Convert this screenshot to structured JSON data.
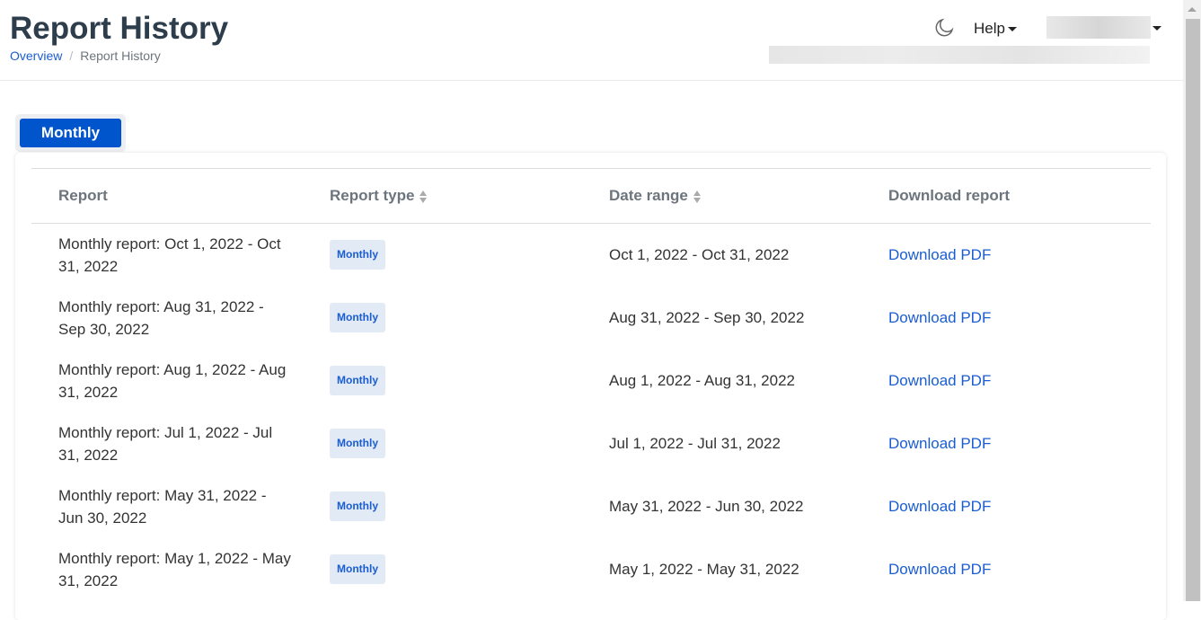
{
  "header": {
    "title": "Report History",
    "breadcrumb": [
      "Overview",
      "Report History"
    ],
    "help": "Help"
  },
  "tabs": [
    "Monthly"
  ],
  "table": {
    "columns": [
      "Report",
      "Report type",
      "Date range",
      "Download report"
    ],
    "rows": [
      {
        "report": "Monthly report: Oct 1, 2022 - Oct 31, 2022",
        "type": "Monthly",
        "range": "Oct 1, 2022 - Oct 31, 2022",
        "download": "Download PDF"
      },
      {
        "report": "Monthly report: Aug 31, 2022 - Sep 30, 2022",
        "type": "Monthly",
        "range": "Aug 31, 2022 - Sep 30, 2022",
        "download": "Download PDF"
      },
      {
        "report": "Monthly report: Aug 1, 2022 - Aug 31, 2022",
        "type": "Monthly",
        "range": "Aug 1, 2022 - Aug 31, 2022",
        "download": "Download PDF"
      },
      {
        "report": "Monthly report: Jul 1, 2022 - Jul 31, 2022",
        "type": "Monthly",
        "range": "Jul 1, 2022 - Jul 31, 2022",
        "download": "Download PDF"
      },
      {
        "report": "Monthly report: May 31, 2022 - Jun 30, 2022",
        "type": "Monthly",
        "range": "May 31, 2022 - Jun 30, 2022",
        "download": "Download PDF"
      },
      {
        "report": "Monthly report: May 1, 2022 - May 31, 2022",
        "type": "Monthly",
        "range": "May 1, 2022 - May 31, 2022",
        "download": "Download PDF"
      }
    ]
  }
}
